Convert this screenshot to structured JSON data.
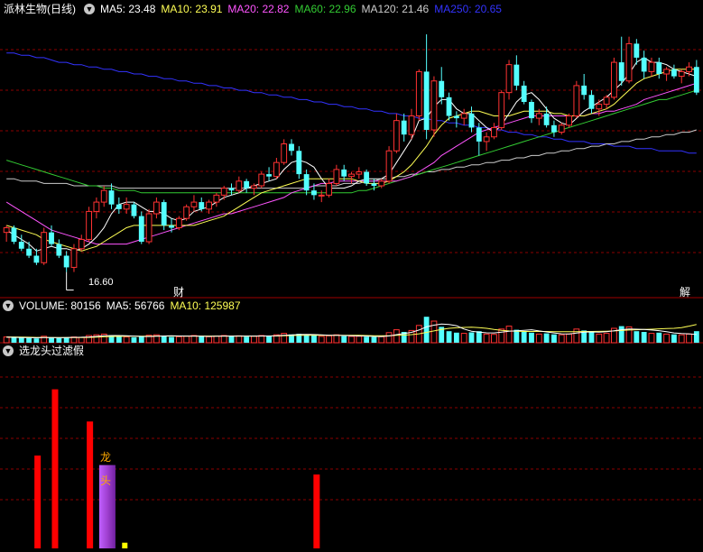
{
  "stock_name": "派林生物(日线)",
  "main_indicators": [
    {
      "label": "MA5: 23.48",
      "color": "#ffffff"
    },
    {
      "label": "MA10: 23.91",
      "color": "#ffff55"
    },
    {
      "label": "MA20: 22.82",
      "color": "#ff55ff"
    },
    {
      "label": "MA60: 22.96",
      "color": "#33cc33"
    },
    {
      "label": "MA120: 21.46",
      "color": "#cccccc"
    },
    {
      "label": "MA250: 20.65",
      "color": "#3333ff"
    }
  ],
  "volume_indicators": [
    {
      "label": "VOLUME: 80156",
      "color": "#ffffff"
    },
    {
      "label": "MA5: 56766",
      "color": "#ffffff"
    },
    {
      "label": "MA10: 125987",
      "color": "#ffff55"
    }
  ],
  "filter_panel_title": "选龙头过滤假",
  "markers": {
    "cai": "财",
    "jie": "解",
    "low_label": "16.60"
  },
  "dragon_label_1": "龙",
  "dragon_label_2": "头",
  "colors": {
    "up": "#ff3232",
    "down": "#54ffff",
    "grid": "#8b0000",
    "ma5": "#ffffff",
    "ma10": "#ffff55",
    "ma20": "#ff55ff",
    "ma60": "#33cc33",
    "ma120": "#cccccc",
    "ma250": "#3333ff",
    "purple": "#b040e0",
    "signal": "#ff0000",
    "small": "#ffff00"
  },
  "chart_data": {
    "type": "candlestick",
    "price_ylim": [
      15.5,
      27.5
    ],
    "candles": [
      [
        18.3,
        18.6,
        17.9,
        18.5
      ],
      [
        18.5,
        18.6,
        17.8,
        17.9
      ],
      [
        17.9,
        18.2,
        17.5,
        17.6
      ],
      [
        17.6,
        17.9,
        17.2,
        17.3
      ],
      [
        17.3,
        17.6,
        16.9,
        17.0
      ],
      [
        17.0,
        18.5,
        16.9,
        18.3
      ],
      [
        18.3,
        18.6,
        17.7,
        17.8
      ],
      [
        17.8,
        18.0,
        17.2,
        17.3
      ],
      [
        17.3,
        17.5,
        16.6,
        16.8
      ],
      [
        16.8,
        17.8,
        16.6,
        17.6
      ],
      [
        17.6,
        18.2,
        17.5,
        18.0
      ],
      [
        18.0,
        19.4,
        17.9,
        19.2
      ],
      [
        19.2,
        19.8,
        18.9,
        19.6
      ],
      [
        19.6,
        20.3,
        19.4,
        20.1
      ],
      [
        20.1,
        20.4,
        19.3,
        19.5
      ],
      [
        19.5,
        19.8,
        19.1,
        19.3
      ],
      [
        19.3,
        19.8,
        19.1,
        19.5
      ],
      [
        19.5,
        19.6,
        18.9,
        19.0
      ],
      [
        19.0,
        19.2,
        17.8,
        17.9
      ],
      [
        17.9,
        19.3,
        17.8,
        19.1
      ],
      [
        19.1,
        19.8,
        18.9,
        19.6
      ],
      [
        19.6,
        19.7,
        18.4,
        18.6
      ],
      [
        18.6,
        18.9,
        18.3,
        18.5
      ],
      [
        18.5,
        19.0,
        18.4,
        18.9
      ],
      [
        18.9,
        19.5,
        18.8,
        19.4
      ],
      [
        19.4,
        19.9,
        19.2,
        19.6
      ],
      [
        19.6,
        19.8,
        19.2,
        19.3
      ],
      [
        19.3,
        19.7,
        19.1,
        19.6
      ],
      [
        19.6,
        20.0,
        19.4,
        19.9
      ],
      [
        19.9,
        20.3,
        19.7,
        20.2
      ],
      [
        20.2,
        20.4,
        19.9,
        20.1
      ],
      [
        20.1,
        20.7,
        20.0,
        20.5
      ],
      [
        20.5,
        20.6,
        20.0,
        20.2
      ],
      [
        20.2,
        20.4,
        19.9,
        20.3
      ],
      [
        20.3,
        20.9,
        20.2,
        20.8
      ],
      [
        20.8,
        21.1,
        20.5,
        20.7
      ],
      [
        20.7,
        21.5,
        20.6,
        21.3
      ],
      [
        21.3,
        22.3,
        21.2,
        22.1
      ],
      [
        22.1,
        22.3,
        21.6,
        21.8
      ],
      [
        21.8,
        22.0,
        20.6,
        20.8
      ],
      [
        20.8,
        21.0,
        19.9,
        20.1
      ],
      [
        20.1,
        20.4,
        19.7,
        19.9
      ],
      [
        19.9,
        20.1,
        19.6,
        19.9
      ],
      [
        19.9,
        20.6,
        19.8,
        20.4
      ],
      [
        20.4,
        21.2,
        20.3,
        21.0
      ],
      [
        21.0,
        21.2,
        20.5,
        20.7
      ],
      [
        20.7,
        20.9,
        20.4,
        20.8
      ],
      [
        20.8,
        21.1,
        20.6,
        20.9
      ],
      [
        20.9,
        21.0,
        20.3,
        20.4
      ],
      [
        20.4,
        20.6,
        20.1,
        20.3
      ],
      [
        20.3,
        20.6,
        20.2,
        20.5
      ],
      [
        20.5,
        22.0,
        20.4,
        21.8
      ],
      [
        21.8,
        23.4,
        21.7,
        23.1
      ],
      [
        23.1,
        23.4,
        22.2,
        22.5
      ],
      [
        22.5,
        23.6,
        22.3,
        23.3
      ],
      [
        23.3,
        25.3,
        23.1,
        25.2
      ],
      [
        25.2,
        26.8,
        22.3,
        22.7
      ],
      [
        22.7,
        25.0,
        22.4,
        24.8
      ],
      [
        24.8,
        25.4,
        23.8,
        24.1
      ],
      [
        24.1,
        24.3,
        23.1,
        23.3
      ],
      [
        23.3,
        23.5,
        22.8,
        23.2
      ],
      [
        23.2,
        23.6,
        22.9,
        23.4
      ],
      [
        23.4,
        23.7,
        22.6,
        22.8
      ],
      [
        22.8,
        23.0,
        21.6,
        22.2
      ],
      [
        22.2,
        22.6,
        21.8,
        22.4
      ],
      [
        22.4,
        23.0,
        22.3,
        22.8
      ],
      [
        22.8,
        24.4,
        22.7,
        24.3
      ],
      [
        24.3,
        25.7,
        24.0,
        25.5
      ],
      [
        25.5,
        25.9,
        24.4,
        24.6
      ],
      [
        24.6,
        24.8,
        23.8,
        23.9
      ],
      [
        23.9,
        24.0,
        23.0,
        23.2
      ],
      [
        23.2,
        23.6,
        22.9,
        23.4
      ],
      [
        23.4,
        23.7,
        22.8,
        22.9
      ],
      [
        22.9,
        23.1,
        22.4,
        22.6
      ],
      [
        22.6,
        23.0,
        22.5,
        22.9
      ],
      [
        22.9,
        23.4,
        22.8,
        23.3
      ],
      [
        23.3,
        24.8,
        23.2,
        24.6
      ],
      [
        24.6,
        25.1,
        24.0,
        24.2
      ],
      [
        24.2,
        24.4,
        23.4,
        23.6
      ],
      [
        23.6,
        24.0,
        23.3,
        23.8
      ],
      [
        23.8,
        24.2,
        23.6,
        24.1
      ],
      [
        24.1,
        25.8,
        24.0,
        25.6
      ],
      [
        25.6,
        26.7,
        24.6,
        24.8
      ],
      [
        24.8,
        26.7,
        24.7,
        26.4
      ],
      [
        26.4,
        26.6,
        25.5,
        25.8
      ],
      [
        25.8,
        26.1,
        24.9,
        25.2
      ],
      [
        25.2,
        25.8,
        25.0,
        25.6
      ],
      [
        25.6,
        25.8,
        24.9,
        25.1
      ],
      [
        25.1,
        25.4,
        24.8,
        25.3
      ],
      [
        25.3,
        25.5,
        24.9,
        25.0
      ],
      [
        25.0,
        25.3,
        24.7,
        25.2
      ],
      [
        25.2,
        25.6,
        25.0,
        25.4
      ],
      [
        25.4,
        25.7,
        24.2,
        24.3
      ]
    ],
    "ma5": [
      18.4,
      18.2,
      18.0,
      17.8,
      17.5,
      17.6,
      17.7,
      17.6,
      17.6,
      17.5,
      17.6,
      17.8,
      18.1,
      18.5,
      19.1,
      19.5,
      19.6,
      19.6,
      19.4,
      19.2,
      19.2,
      19.1,
      18.9,
      18.8,
      18.9,
      19.2,
      19.3,
      19.4,
      19.6,
      19.8,
      19.9,
      20.0,
      20.2,
      20.3,
      20.4,
      20.5,
      20.6,
      21.0,
      21.3,
      21.4,
      21.3,
      21.1,
      20.6,
      20.2,
      20.2,
      20.2,
      20.3,
      20.5,
      20.6,
      20.6,
      20.6,
      20.8,
      21.3,
      21.8,
      22.3,
      23.1,
      23.2,
      23.7,
      24.0,
      24.0,
      23.6,
      23.4,
      23.4,
      23.1,
      22.8,
      22.6,
      22.9,
      23.4,
      23.9,
      24.2,
      24.3,
      24.0,
      23.6,
      23.2,
      23.0,
      22.9,
      23.2,
      23.5,
      23.7,
      23.9,
      24.1,
      24.4,
      24.7,
      25.1,
      25.6,
      25.8,
      25.6,
      25.6,
      25.5,
      25.3,
      25.2,
      25.1,
      25.0
    ],
    "ma10": [
      18.6,
      18.5,
      18.4,
      18.3,
      18.2,
      18.0,
      17.9,
      17.8,
      17.7,
      17.6,
      17.5,
      17.6,
      17.7,
      17.9,
      18.1,
      18.3,
      18.5,
      18.6,
      18.6,
      18.6,
      18.6,
      18.6,
      18.6,
      18.6,
      18.6,
      18.6,
      18.7,
      18.8,
      18.9,
      19.0,
      19.2,
      19.4,
      19.6,
      19.8,
      20.0,
      20.1,
      20.2,
      20.3,
      20.4,
      20.5,
      20.6,
      20.6,
      20.6,
      20.6,
      20.6,
      20.6,
      20.6,
      20.5,
      20.4,
      20.4,
      20.4,
      20.5,
      20.7,
      20.9,
      21.2,
      21.6,
      22.0,
      22.5,
      22.9,
      23.2,
      23.3,
      23.4,
      23.5,
      23.5,
      23.4,
      23.3,
      23.3,
      23.3,
      23.4,
      23.5,
      23.5,
      23.5,
      23.5,
      23.4,
      23.4,
      23.3,
      23.3,
      23.3,
      23.4,
      23.5,
      23.6,
      23.8,
      24.1,
      24.4,
      24.7,
      24.9,
      25.0,
      25.1,
      25.2,
      25.3,
      25.3,
      25.3,
      25.3
    ],
    "ma20": [
      19.6,
      19.4,
      19.2,
      19.0,
      18.8,
      18.6,
      18.4,
      18.3,
      18.2,
      18.1,
      18.0,
      17.9,
      17.8,
      17.8,
      17.8,
      17.8,
      17.8,
      17.9,
      18.0,
      18.1,
      18.2,
      18.3,
      18.4,
      18.5,
      18.6,
      18.7,
      18.8,
      18.9,
      19.0,
      19.1,
      19.1,
      19.2,
      19.3,
      19.4,
      19.5,
      19.6,
      19.7,
      19.8,
      20.0,
      20.1,
      20.2,
      20.3,
      20.4,
      20.4,
      20.5,
      20.5,
      20.5,
      20.5,
      20.5,
      20.5,
      20.5,
      20.5,
      20.5,
      20.6,
      20.7,
      20.9,
      21.1,
      21.3,
      21.6,
      21.8,
      22.0,
      22.2,
      22.4,
      22.6,
      22.7,
      22.8,
      22.9,
      23.0,
      23.1,
      23.2,
      23.3,
      23.3,
      23.3,
      23.3,
      23.3,
      23.3,
      23.3,
      23.3,
      23.4,
      23.4,
      23.5,
      23.5,
      23.6,
      23.7,
      23.8,
      24.0,
      24.1,
      24.2,
      24.3,
      24.4,
      24.5,
      24.6,
      24.7
    ],
    "ma60": [
      21.4,
      21.3,
      21.2,
      21.1,
      21.0,
      20.9,
      20.8,
      20.7,
      20.6,
      20.5,
      20.4,
      20.3,
      20.3,
      20.2,
      20.2,
      20.1,
      20.1,
      20.1,
      20.0,
      20.0,
      20.0,
      20.0,
      20.0,
      20.0,
      20.0,
      20.0,
      20.0,
      20.0,
      20.0,
      20.0,
      20.0,
      20.0,
      20.0,
      20.0,
      20.0,
      20.0,
      20.0,
      20.0,
      20.0,
      20.0,
      20.0,
      20.0,
      20.0,
      20.0,
      20.0,
      20.0,
      20.0,
      20.1,
      20.1,
      20.2,
      20.3,
      20.4,
      20.5,
      20.6,
      20.7,
      20.8,
      20.9,
      21.0,
      21.1,
      21.2,
      21.3,
      21.4,
      21.5,
      21.6,
      21.7,
      21.8,
      21.9,
      22.0,
      22.1,
      22.2,
      22.3,
      22.4,
      22.5,
      22.6,
      22.7,
      22.8,
      22.9,
      23.0,
      23.1,
      23.2,
      23.3,
      23.4,
      23.5,
      23.6,
      23.7,
      23.8,
      23.9,
      24.0,
      24.0,
      24.1,
      24.2,
      24.3,
      24.4
    ],
    "ma120": [
      20.6,
      20.6,
      20.5,
      20.5,
      20.5,
      20.4,
      20.4,
      20.4,
      20.4,
      20.3,
      20.3,
      20.3,
      20.3,
      20.3,
      20.3,
      20.2,
      20.2,
      20.2,
      20.2,
      20.2,
      20.2,
      20.2,
      20.2,
      20.2,
      20.2,
      20.2,
      20.2,
      20.2,
      20.2,
      20.2,
      20.2,
      20.2,
      20.2,
      20.2,
      20.2,
      20.2,
      20.2,
      20.2,
      20.2,
      20.2,
      20.2,
      20.3,
      20.3,
      20.3,
      20.3,
      20.4,
      20.4,
      20.4,
      20.5,
      20.5,
      20.6,
      20.6,
      20.7,
      20.7,
      20.8,
      20.8,
      20.9,
      20.9,
      21.0,
      21.0,
      21.1,
      21.1,
      21.2,
      21.2,
      21.3,
      21.3,
      21.4,
      21.4,
      21.5,
      21.5,
      21.6,
      21.6,
      21.7,
      21.7,
      21.8,
      21.8,
      21.9,
      21.9,
      22.0,
      22.0,
      22.1,
      22.1,
      22.2,
      22.2,
      22.3,
      22.3,
      22.4,
      22.4,
      22.5,
      22.5,
      22.6,
      22.6,
      22.7
    ],
    "ma250": [
      26.0,
      26.0,
      25.9,
      25.9,
      25.8,
      25.8,
      25.7,
      25.6,
      25.6,
      25.5,
      25.5,
      25.4,
      25.4,
      25.3,
      25.3,
      25.2,
      25.2,
      25.1,
      25.1,
      25.0,
      25.0,
      24.9,
      24.9,
      24.8,
      24.8,
      24.7,
      24.7,
      24.6,
      24.6,
      24.5,
      24.5,
      24.4,
      24.4,
      24.3,
      24.3,
      24.2,
      24.2,
      24.1,
      24.1,
      24.0,
      24.0,
      23.9,
      23.9,
      23.8,
      23.8,
      23.7,
      23.7,
      23.6,
      23.6,
      23.5,
      23.5,
      23.4,
      23.4,
      23.3,
      23.3,
      23.2,
      23.2,
      23.1,
      23.1,
      23.0,
      23.0,
      22.9,
      22.9,
      22.8,
      22.8,
      22.7,
      22.7,
      22.6,
      22.6,
      22.5,
      22.5,
      22.4,
      22.4,
      22.3,
      22.3,
      22.2,
      22.2,
      22.2,
      22.1,
      22.1,
      22.1,
      22.0,
      22.0,
      22.0,
      21.9,
      21.9,
      21.9,
      21.8,
      21.8,
      21.8,
      21.8,
      21.7,
      21.7
    ],
    "volume_ylim": [
      0,
      200000
    ],
    "volume": [
      40000,
      38000,
      35000,
      33000,
      30000,
      45000,
      35000,
      32000,
      36000,
      40000,
      38000,
      50000,
      55000,
      60000,
      48000,
      42000,
      40000,
      38000,
      45000,
      52000,
      55000,
      48000,
      40000,
      42000,
      45000,
      50000,
      44000,
      42000,
      46000,
      50000,
      44000,
      48000,
      42000,
      45000,
      50000,
      47000,
      55000,
      65000,
      58000,
      62000,
      55000,
      50000,
      44000,
      48000,
      55000,
      46000,
      44000,
      45000,
      42000,
      40000,
      42000,
      70000,
      90000,
      75000,
      85000,
      120000,
      180000,
      150000,
      110000,
      80000,
      70000,
      65000,
      72000,
      80000,
      60000,
      58000,
      95000,
      115000,
      90000,
      75000,
      70000,
      60000,
      65000,
      58000,
      55000,
      60000,
      95000,
      85000,
      72000,
      60000,
      65000,
      100000,
      115000,
      110000,
      80000,
      75000,
      65000,
      70000,
      60000,
      58000,
      55000,
      60000,
      80156
    ],
    "vol_ma5": [
      38000,
      37500,
      36000,
      35000,
      34500,
      36000,
      35500,
      35000,
      36000,
      37500,
      38000,
      40000,
      44000,
      48000,
      50000,
      50000,
      48000,
      46000,
      44000,
      43000,
      45000,
      47000,
      48000,
      47000,
      46000,
      46000,
      45000,
      44000,
      45000,
      46000,
      46000,
      46000,
      46000,
      46000,
      47000,
      47000,
      48000,
      52000,
      54000,
      57000,
      58000,
      57000,
      55000,
      52000,
      51000,
      50000,
      49000,
      47000,
      46000,
      44000,
      43000,
      47000,
      56000,
      64000,
      72000,
      88000,
      110000,
      122000,
      130000,
      127000,
      118000,
      95000,
      80000,
      73000,
      69000,
      68000,
      74000,
      80000,
      83000,
      86000,
      90000,
      82000,
      75000,
      68000,
      62000,
      61000,
      67000,
      73000,
      75000,
      74000,
      76000,
      83000,
      90000,
      95000,
      94000,
      92000,
      88000,
      84000,
      76000,
      68000,
      64000,
      62000,
      56766
    ],
    "vol_ma10": [
      40000,
      40000,
      39000,
      38000,
      37000,
      37000,
      36500,
      36000,
      36000,
      36000,
      36000,
      37000,
      39000,
      41000,
      43000,
      44000,
      45000,
      45000,
      45000,
      45000,
      46000,
      46000,
      46000,
      46000,
      46000,
      46000,
      46000,
      46000,
      46000,
      46000,
      46000,
      46000,
      46000,
      46000,
      46000,
      47000,
      47000,
      48000,
      50000,
      51000,
      52000,
      52000,
      52000,
      52000,
      52000,
      52000,
      52000,
      51000,
      50000,
      49000,
      48000,
      49000,
      51000,
      53000,
      56000,
      62000,
      72000,
      82000,
      92000,
      100000,
      104000,
      106000,
      108000,
      105000,
      100000,
      92000,
      86000,
      82000,
      80000,
      78000,
      78000,
      78000,
      78000,
      77000,
      76000,
      76000,
      77000,
      78000,
      78000,
      79000,
      80000,
      82000,
      85000,
      88000,
      90000,
      92000,
      94000,
      96000,
      98000,
      100000,
      105000,
      115000,
      125987
    ],
    "bars": [
      {
        "index": 1,
        "height": 0.49,
        "color": "red"
      },
      {
        "index": 2,
        "height": 0.84,
        "color": "red"
      },
      {
        "index": 4,
        "height": 0.67,
        "color": "red"
      },
      {
        "index": 5,
        "height": 0.44,
        "color": "purple"
      },
      {
        "index": 6,
        "height": 0.03,
        "color": "yellow"
      },
      {
        "index": 17,
        "height": 0.39,
        "color": "red"
      }
    ]
  }
}
